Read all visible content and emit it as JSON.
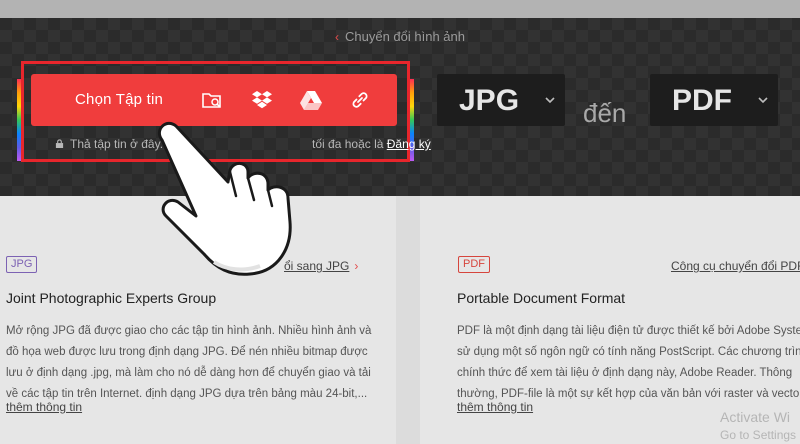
{
  "header": {
    "back_link": "Chuyển đổi hình ảnh"
  },
  "uploader": {
    "choose_label": "Chọn Tập tin",
    "sources": [
      {
        "icon": "folder-search-icon"
      },
      {
        "icon": "dropbox-icon"
      },
      {
        "icon": "google-drive-icon"
      },
      {
        "icon": "link-icon"
      }
    ],
    "hint_before": "Thả tập tin ở đây.",
    "hint_after": "tối đa hoặc là",
    "register_label": "Đăng ký"
  },
  "converter": {
    "from_format": "JPG",
    "to_word": "đến",
    "to_format": "PDF"
  },
  "cards": [
    {
      "badge": "JPG",
      "link": "ổi sang JPG",
      "title": "Joint Photographic Experts Group",
      "lines": [
        "Mở rộng JPG đã được giao cho các tập tin hình ảnh. Nhiều hình ảnh và",
        "đồ họa web được lưu trong định dạng JPG. Để nén nhiều bitmap được",
        "lưu ở định dạng .jpg, mà làm cho nó dễ dàng hơn để chuyển giao và tải",
        "về các tập tin trên Internet. định dạng JPG dựa trên bảng màu 24-bit,..."
      ],
      "more": "thêm thông tin"
    },
    {
      "badge": "PDF",
      "link": "Công cụ chuyển đổi PDF",
      "title": "Portable Document Format",
      "lines": [
        "PDF là một định dạng tài liệu điện tử được thiết kế bởi Adobe Systems",
        "sử dụng một số ngôn ngữ có tính năng PostScript. Các chương trình",
        "chính thức để xem tài liệu ở định dạng này, Adobe Reader. Thông",
        "thường, PDF-file là một sự kết hợp của văn bản với raster và vector đ"
      ],
      "more": "thêm thông tin"
    }
  ],
  "watermark": {
    "line1": "Activate Wi",
    "line2": "Go to Settings"
  },
  "colors": {
    "brand_red": "#f03d3d",
    "hero_bg": "#2b2b2b"
  }
}
